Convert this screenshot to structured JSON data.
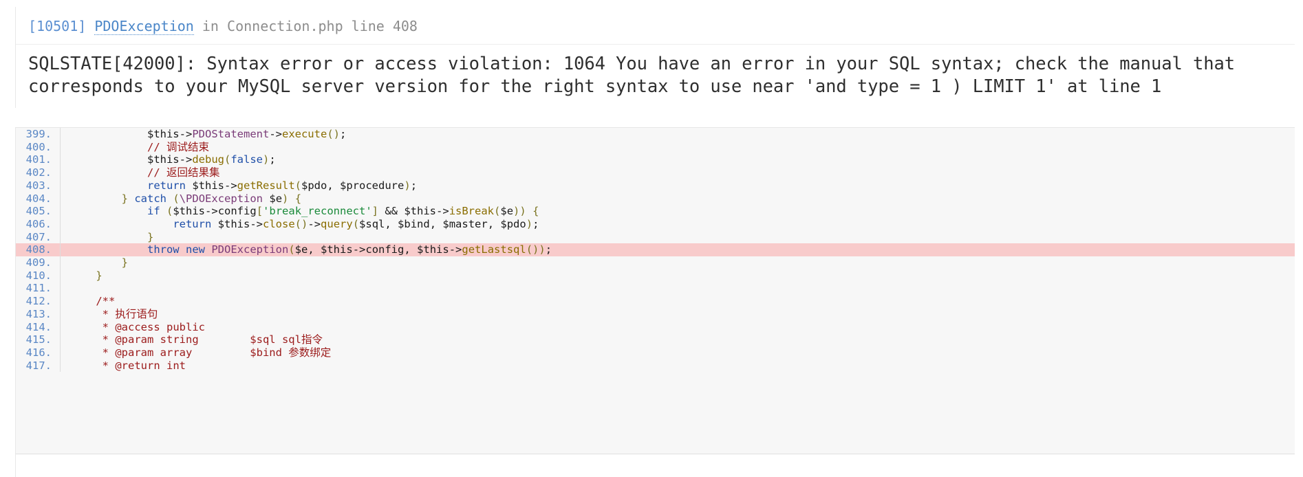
{
  "exception": {
    "code": "[10501]",
    "class": "PDOException",
    "preposition": "in",
    "file": "Connection.php line 408",
    "message": "SQLSTATE[42000]: Syntax error or access violation: 1064 You have an error in your SQL syntax; check the manual that corresponds to your MySQL server version for the right syntax to use near 'and type = 1 ) LIMIT 1' at line 1"
  },
  "colors": {
    "link": "#4a86c8",
    "code_badge": "#5b8fd1",
    "muted": "#8d8d8d",
    "line_number": "#5a87c5",
    "highlight_row": "#f8cbcb",
    "source_bg": "#f7f7f7",
    "keyword": "#1f4fa8",
    "string": "#1a8a3a",
    "comment": "#9b1b1b",
    "function": "#8a6d00",
    "method": "#7a3b78",
    "punctuation": "#7a7320"
  },
  "source": {
    "highlight_line": 408,
    "lines": [
      {
        "num": "399.",
        "tokens": [
          {
            "t": "            ",
            "c": "plain"
          },
          {
            "t": "$this",
            "c": "var"
          },
          {
            "t": "->",
            "c": "plain"
          },
          {
            "t": "PDOStatement",
            "c": "meth"
          },
          {
            "t": "->",
            "c": "plain"
          },
          {
            "t": "execute",
            "c": "fn"
          },
          {
            "t": "(",
            "c": "pun"
          },
          {
            "t": ")",
            "c": "pun"
          },
          {
            "t": ";",
            "c": "plain"
          }
        ]
      },
      {
        "num": "400.",
        "tokens": [
          {
            "t": "            ",
            "c": "plain"
          },
          {
            "t": "// 调试结束",
            "c": "com"
          }
        ]
      },
      {
        "num": "401.",
        "tokens": [
          {
            "t": "            ",
            "c": "plain"
          },
          {
            "t": "$this",
            "c": "var"
          },
          {
            "t": "->",
            "c": "plain"
          },
          {
            "t": "debug",
            "c": "fn"
          },
          {
            "t": "(",
            "c": "pun"
          },
          {
            "t": "false",
            "c": "kw"
          },
          {
            "t": ")",
            "c": "pun"
          },
          {
            "t": ";",
            "c": "plain"
          }
        ]
      },
      {
        "num": "402.",
        "tokens": [
          {
            "t": "            ",
            "c": "plain"
          },
          {
            "t": "// 返回结果集",
            "c": "com"
          }
        ]
      },
      {
        "num": "403.",
        "tokens": [
          {
            "t": "            ",
            "c": "plain"
          },
          {
            "t": "return",
            "c": "kw"
          },
          {
            "t": " ",
            "c": "plain"
          },
          {
            "t": "$this",
            "c": "var"
          },
          {
            "t": "->",
            "c": "plain"
          },
          {
            "t": "getResult",
            "c": "fn"
          },
          {
            "t": "(",
            "c": "pun"
          },
          {
            "t": "$pdo",
            "c": "var"
          },
          {
            "t": ", ",
            "c": "plain"
          },
          {
            "t": "$procedure",
            "c": "var"
          },
          {
            "t": ")",
            "c": "pun"
          },
          {
            "t": ";",
            "c": "plain"
          }
        ]
      },
      {
        "num": "404.",
        "tokens": [
          {
            "t": "        ",
            "c": "plain"
          },
          {
            "t": "}",
            "c": "pun"
          },
          {
            "t": " ",
            "c": "plain"
          },
          {
            "t": "catch",
            "c": "kw"
          },
          {
            "t": " ",
            "c": "plain"
          },
          {
            "t": "(",
            "c": "pun"
          },
          {
            "t": "\\PDOException",
            "c": "cls"
          },
          {
            "t": " ",
            "c": "plain"
          },
          {
            "t": "$e",
            "c": "var"
          },
          {
            "t": ")",
            "c": "pun"
          },
          {
            "t": " ",
            "c": "plain"
          },
          {
            "t": "{",
            "c": "pun"
          }
        ]
      },
      {
        "num": "405.",
        "tokens": [
          {
            "t": "            ",
            "c": "plain"
          },
          {
            "t": "if",
            "c": "kw"
          },
          {
            "t": " ",
            "c": "plain"
          },
          {
            "t": "(",
            "c": "pun"
          },
          {
            "t": "$this",
            "c": "var"
          },
          {
            "t": "->",
            "c": "plain"
          },
          {
            "t": "config",
            "c": "plain"
          },
          {
            "t": "[",
            "c": "pun"
          },
          {
            "t": "'break_reconnect'",
            "c": "str"
          },
          {
            "t": "]",
            "c": "pun"
          },
          {
            "t": " && ",
            "c": "plain"
          },
          {
            "t": "$this",
            "c": "var"
          },
          {
            "t": "->",
            "c": "plain"
          },
          {
            "t": "isBreak",
            "c": "fn"
          },
          {
            "t": "(",
            "c": "pun"
          },
          {
            "t": "$e",
            "c": "var"
          },
          {
            "t": ")",
            "c": "pun"
          },
          {
            "t": ")",
            "c": "pun"
          },
          {
            "t": " ",
            "c": "plain"
          },
          {
            "t": "{",
            "c": "pun"
          }
        ]
      },
      {
        "num": "406.",
        "tokens": [
          {
            "t": "                ",
            "c": "plain"
          },
          {
            "t": "return",
            "c": "kw"
          },
          {
            "t": " ",
            "c": "plain"
          },
          {
            "t": "$this",
            "c": "var"
          },
          {
            "t": "->",
            "c": "plain"
          },
          {
            "t": "close",
            "c": "fn"
          },
          {
            "t": "(",
            "c": "pun"
          },
          {
            "t": ")",
            "c": "pun"
          },
          {
            "t": "->",
            "c": "plain"
          },
          {
            "t": "query",
            "c": "fn"
          },
          {
            "t": "(",
            "c": "pun"
          },
          {
            "t": "$sql",
            "c": "var"
          },
          {
            "t": ", ",
            "c": "plain"
          },
          {
            "t": "$bind",
            "c": "var"
          },
          {
            "t": ", ",
            "c": "plain"
          },
          {
            "t": "$master",
            "c": "var"
          },
          {
            "t": ", ",
            "c": "plain"
          },
          {
            "t": "$pdo",
            "c": "var"
          },
          {
            "t": ")",
            "c": "pun"
          },
          {
            "t": ";",
            "c": "plain"
          }
        ]
      },
      {
        "num": "407.",
        "tokens": [
          {
            "t": "            ",
            "c": "plain"
          },
          {
            "t": "}",
            "c": "pun"
          }
        ]
      },
      {
        "num": "408.",
        "tokens": [
          {
            "t": "            ",
            "c": "plain"
          },
          {
            "t": "throw",
            "c": "kw"
          },
          {
            "t": " ",
            "c": "plain"
          },
          {
            "t": "new",
            "c": "kw"
          },
          {
            "t": " ",
            "c": "plain"
          },
          {
            "t": "PDOException",
            "c": "cls"
          },
          {
            "t": "(",
            "c": "pun"
          },
          {
            "t": "$e",
            "c": "var"
          },
          {
            "t": ", ",
            "c": "plain"
          },
          {
            "t": "$this",
            "c": "var"
          },
          {
            "t": "->",
            "c": "plain"
          },
          {
            "t": "config",
            "c": "plain"
          },
          {
            "t": ", ",
            "c": "plain"
          },
          {
            "t": "$this",
            "c": "var"
          },
          {
            "t": "->",
            "c": "plain"
          },
          {
            "t": "getLastsql",
            "c": "fn"
          },
          {
            "t": "(",
            "c": "pun"
          },
          {
            "t": ")",
            "c": "pun"
          },
          {
            "t": ")",
            "c": "pun"
          },
          {
            "t": ";",
            "c": "plain"
          }
        ]
      },
      {
        "num": "409.",
        "tokens": [
          {
            "t": "        ",
            "c": "plain"
          },
          {
            "t": "}",
            "c": "pun"
          }
        ]
      },
      {
        "num": "410.",
        "tokens": [
          {
            "t": "    ",
            "c": "plain"
          },
          {
            "t": "}",
            "c": "pun"
          }
        ]
      },
      {
        "num": "411.",
        "tokens": [
          {
            "t": "",
            "c": "plain"
          }
        ]
      },
      {
        "num": "412.",
        "tokens": [
          {
            "t": "    ",
            "c": "plain"
          },
          {
            "t": "/**",
            "c": "doc"
          }
        ]
      },
      {
        "num": "413.",
        "tokens": [
          {
            "t": "     ",
            "c": "plain"
          },
          {
            "t": "* 执行语句",
            "c": "doc"
          }
        ]
      },
      {
        "num": "414.",
        "tokens": [
          {
            "t": "     ",
            "c": "plain"
          },
          {
            "t": "* @access public",
            "c": "doc"
          }
        ]
      },
      {
        "num": "415.",
        "tokens": [
          {
            "t": "     ",
            "c": "plain"
          },
          {
            "t": "* @param string        $sql sql指令",
            "c": "doc"
          }
        ]
      },
      {
        "num": "416.",
        "tokens": [
          {
            "t": "     ",
            "c": "plain"
          },
          {
            "t": "* @param array         $bind 参数绑定",
            "c": "doc"
          }
        ]
      },
      {
        "num": "417.",
        "tokens": [
          {
            "t": "     ",
            "c": "plain"
          },
          {
            "t": "* @return int",
            "c": "doc"
          }
        ]
      }
    ]
  }
}
